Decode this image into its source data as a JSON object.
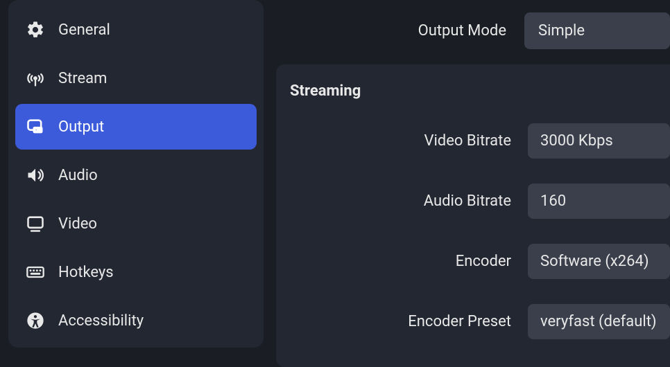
{
  "sidebar": {
    "items": [
      {
        "id": "general",
        "label": "General",
        "active": false
      },
      {
        "id": "stream",
        "label": "Stream",
        "active": false
      },
      {
        "id": "output",
        "label": "Output",
        "active": true
      },
      {
        "id": "audio",
        "label": "Audio",
        "active": false
      },
      {
        "id": "video",
        "label": "Video",
        "active": false
      },
      {
        "id": "hotkeys",
        "label": "Hotkeys",
        "active": false
      },
      {
        "id": "accessibility",
        "label": "Accessibility",
        "active": false
      }
    ]
  },
  "output_mode": {
    "label": "Output Mode",
    "value": "Simple"
  },
  "streaming": {
    "title": "Streaming",
    "video_bitrate": {
      "label": "Video Bitrate",
      "value": "3000 Kbps"
    },
    "audio_bitrate": {
      "label": "Audio Bitrate",
      "value": "160"
    },
    "encoder": {
      "label": "Encoder",
      "value": "Software (x264)"
    },
    "encoder_preset": {
      "label": "Encoder Preset",
      "value": "veryfast (default)"
    }
  }
}
